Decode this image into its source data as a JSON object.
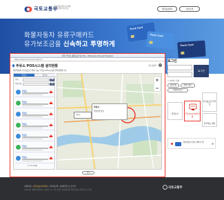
{
  "header": {
    "logo_text": "국토교통부",
    "logo_sub": "화물자동차유류구매카드 통합관리시스템",
    "buttons": [
      "개인정보처리",
      "사이트맵"
    ]
  },
  "hero": {
    "line1": "화물자동차 유류구매카드",
    "line2_prefix": "유가보조금을 ",
    "line2_bold": "신속하고 투명하게",
    "cards": [
      "Truck Card",
      "Truck Card",
      "Truck Card"
    ]
  },
  "popup": {
    "window_title": "유류 주유소 통합조회 및 Ktrs - Windows Internet Explorer",
    "url": "https://www.truckcard.kr/index.do",
    "heading": "주유소 POS시스템 설치현황",
    "brand": "국토교통부",
    "close_symbol": "×",
    "description": "화물자동차 유가보조금 결제 가능 주유소 POS시스템 설치현황입니다.",
    "tabs": [
      "주유소",
      "충전소"
    ],
    "search_rows": [
      {
        "label": "지역",
        "button": "검색"
      },
      {
        "label": "주유소명",
        "button": "검색"
      }
    ],
    "list_items": [
      {
        "name": "주유소"
      },
      {
        "name": "주유소"
      },
      {
        "name": "주유소"
      },
      {
        "name": "주유소"
      },
      {
        "name": "주유소"
      },
      {
        "name": "주유소"
      },
      {
        "name": "주유소"
      }
    ],
    "pager": "1 2 3 4 5 ▶",
    "map_popup_title": "주유소",
    "map_popup_line": "주유소명 주소",
    "map_bubble": "주유소",
    "footer_button": "닫기"
  },
  "login": {
    "title": "로그인",
    "login_button": "로그인",
    "save_id": "아이디 저장",
    "links": [
      "회원가입",
      "아이디찾기",
      "비밀번호찾기"
    ]
  },
  "quick": {
    "left_box": "유류단가",
    "highlight_box": "주유소POS설치현황",
    "right_box": "유가보조금 주유소",
    "link": "자주하는 질문"
  },
  "banner": {
    "text": "화물자동차 유류구매카드제"
  },
  "footer": {
    "links_prefix": "이용약관 | ",
    "links_accent": "개인정보처리방침",
    "links_suffix": " | 저작권정책 | 이메일무단수집거부",
    "address": "(30103) 세종특별자치시 도움6로 11 국토교통부 물류정책과 화물자동차 유가보조금 담당",
    "logo_text": "국토교통부"
  },
  "colors": {
    "hero_start": "#1f4fa4",
    "hero_end": "#5a9be0",
    "highlight": "#e8352a",
    "footer_bg": "#2d2f33"
  }
}
